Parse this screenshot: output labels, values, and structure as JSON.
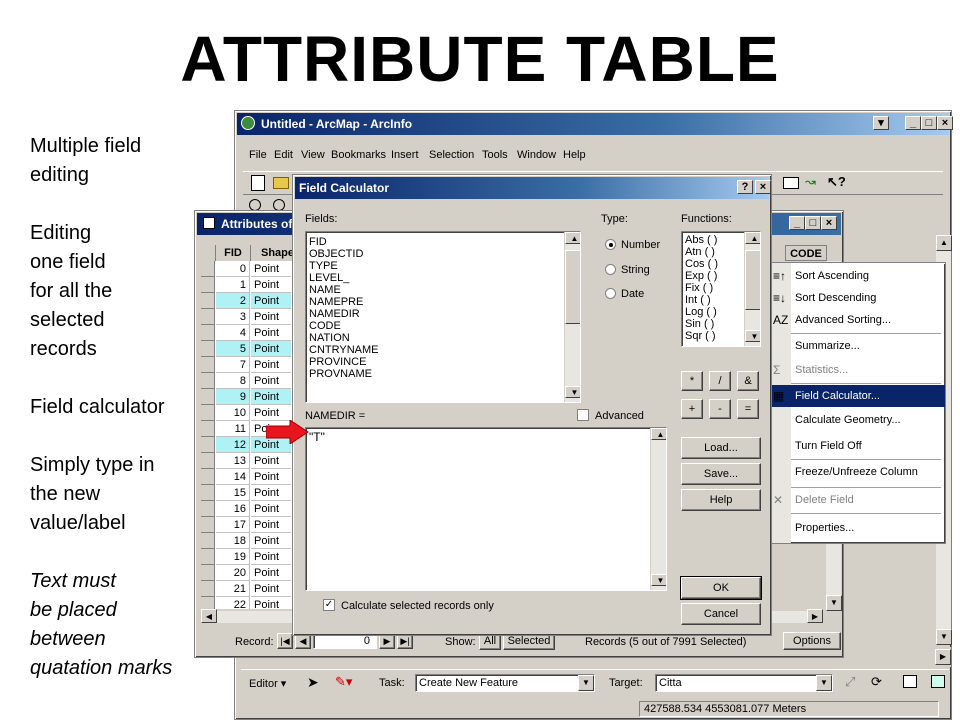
{
  "slide": {
    "title": "ATTRIBUTE TABLE",
    "notes": [
      {
        "lines": [
          "Multiple field",
          "editing"
        ],
        "italic": false
      },
      {
        "lines": [
          "Editing",
          "one field",
          "for all the",
          "selected",
          "records"
        ],
        "italic": false
      },
      {
        "lines": [
          "Field calculator"
        ],
        "italic": false
      },
      {
        "lines": [
          "Simply type in",
          "the new",
          "value/label"
        ],
        "italic": false
      },
      {
        "lines": [
          "Text must",
          "be placed",
          "between",
          "quatation marks"
        ],
        "italic": true
      }
    ]
  },
  "arcmap": {
    "title": "Untitled - ArcMap - ArcInfo",
    "menu": [
      "File",
      "Edit",
      "View",
      "Bookmarks",
      "Insert",
      "Selection",
      "Tools",
      "Window",
      "Help"
    ],
    "editor_label": "Editor",
    "task_label": "Task:",
    "task_value": "Create New Feature",
    "target_label": "Target:",
    "target_value": "Citta",
    "status_coords": "427588.534  4553081.077 Meters"
  },
  "attributes": {
    "title": "Attributes of ...",
    "columns": [
      "FID",
      "Shape"
    ],
    "code_header": "CODE",
    "rows": [
      {
        "fid": "0",
        "shape": "Point",
        "selected": false
      },
      {
        "fid": "1",
        "shape": "Point",
        "selected": false
      },
      {
        "fid": "2",
        "shape": "Point",
        "selected": true
      },
      {
        "fid": "3",
        "shape": "Point",
        "selected": false
      },
      {
        "fid": "4",
        "shape": "Point",
        "selected": false
      },
      {
        "fid": "5",
        "shape": "Point",
        "selected": true
      },
      {
        "fid": "7",
        "shape": "Point",
        "selected": false
      },
      {
        "fid": "8",
        "shape": "Point",
        "selected": false
      },
      {
        "fid": "9",
        "shape": "Point",
        "selected": true
      },
      {
        "fid": "10",
        "shape": "Point",
        "selected": false
      },
      {
        "fid": "11",
        "shape": "Poi",
        "selected": false
      },
      {
        "fid": "12",
        "shape": "Point",
        "selected": true
      },
      {
        "fid": "13",
        "shape": "Point",
        "selected": false
      },
      {
        "fid": "14",
        "shape": "Point",
        "selected": false
      },
      {
        "fid": "15",
        "shape": "Point",
        "selected": false
      },
      {
        "fid": "16",
        "shape": "Point",
        "selected": false
      },
      {
        "fid": "17",
        "shape": "Point",
        "selected": false
      },
      {
        "fid": "18",
        "shape": "Point",
        "selected": false
      },
      {
        "fid": "19",
        "shape": "Point",
        "selected": false
      },
      {
        "fid": "20",
        "shape": "Point",
        "selected": false
      },
      {
        "fid": "21",
        "shape": "Point",
        "selected": false
      },
      {
        "fid": "22",
        "shape": "Point",
        "selected": false
      }
    ],
    "record_label": "Record:",
    "record_value": "0",
    "show_label": "Show:",
    "show_all": "All",
    "show_selected": "Selected",
    "records_info": "Records (5 out of 7991 Selected)",
    "options_label": "Options"
  },
  "field_calculator": {
    "title": "Field Calculator",
    "fields_label": "Fields:",
    "fields": [
      "FID",
      "OBJECTID",
      "TYPE",
      "LEVEL_",
      "NAME",
      "NAMEPRE",
      "NAMEDIR",
      "CODE",
      "NATION",
      "CNTRYNAME",
      "PROVINCE",
      "PROVNAME"
    ],
    "type_label": "Type:",
    "types": [
      "Number",
      "String",
      "Date"
    ],
    "type_selected": "Number",
    "functions_label": "Functions:",
    "functions": [
      "Abs ( )",
      "Atn ( )",
      "Cos ( )",
      "Exp ( )",
      "Fix ( )",
      "Int ( )",
      "Log ( )",
      "Sin ( )",
      "Sqr ( )"
    ],
    "operators": [
      "*",
      "/",
      "&",
      "+",
      "-",
      "="
    ],
    "expression_label": "NAMEDIR =",
    "advanced_label": "Advanced",
    "expression_value": "\"T\"",
    "load_label": "Load...",
    "save_label": "Save...",
    "help_label": "Help",
    "ok_label": "OK",
    "cancel_label": "Cancel",
    "calc_selected_label": "Calculate selected records only"
  },
  "context_menu": {
    "items": [
      {
        "label": "Sort Ascending",
        "icon": "sort-ascending-icon",
        "state": "normal"
      },
      {
        "label": "Sort Descending",
        "icon": "sort-descending-icon",
        "state": "normal"
      },
      {
        "label": "Advanced Sorting...",
        "icon": "advanced-sort-icon",
        "state": "normal"
      },
      {
        "label": "Summarize...",
        "icon": "",
        "state": "normal"
      },
      {
        "label": "Statistics...",
        "icon": "sigma-icon",
        "state": "disabled"
      },
      {
        "label": "Field Calculator...",
        "icon": "calculator-icon",
        "state": "selected"
      },
      {
        "label": "Calculate Geometry...",
        "icon": "",
        "state": "normal"
      },
      {
        "label": "Turn Field Off",
        "icon": "",
        "state": "normal"
      },
      {
        "label": "Freeze/Unfreeze Column",
        "icon": "",
        "state": "normal"
      },
      {
        "label": "Delete Field",
        "icon": "delete-x-icon",
        "state": "disabled"
      },
      {
        "label": "Properties...",
        "icon": "",
        "state": "normal"
      }
    ]
  },
  "colors": {
    "titlebar": "#0a246a",
    "selected_row": "#aef2f6",
    "arrow": "#e8141e"
  }
}
